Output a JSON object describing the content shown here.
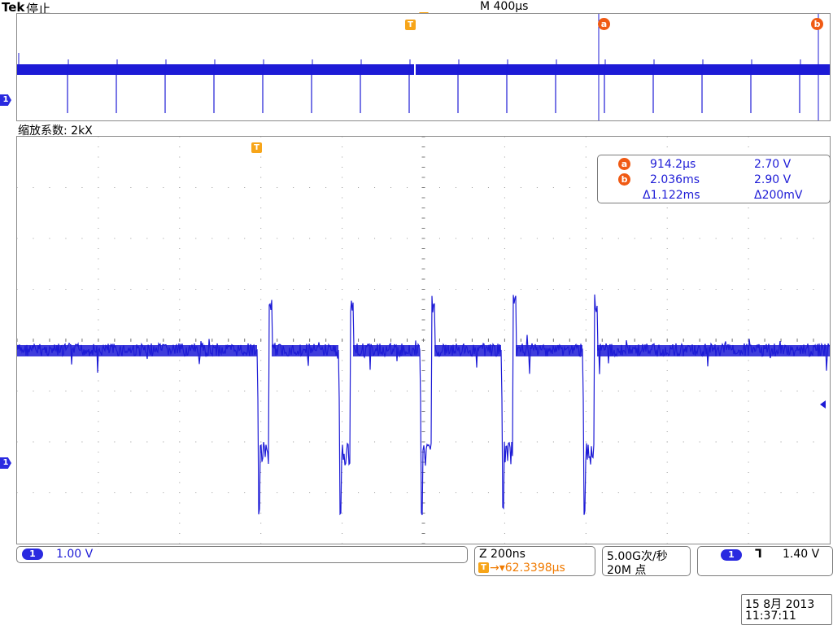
{
  "header": {
    "brand": "Tek",
    "status": "停止",
    "timebase": "M 400µs"
  },
  "overview": {
    "cursor_a_label": "a",
    "cursor_b_label": "b",
    "trigger_label": "T",
    "channel_indicator": "1"
  },
  "zoom": {
    "factor_label": "缩放系数: 2kX",
    "trigger_label": "T",
    "channel_indicator": "1"
  },
  "readout": {
    "a_label": "a",
    "a_time": "914.2µs",
    "a_volt": "2.70 V",
    "b_label": "b",
    "b_time": "2.036ms",
    "b_volt": "2.90 V",
    "delta_time": "Δ1.122ms",
    "delta_volt": "Δ200mV"
  },
  "status_bar": {
    "channel_badge": "1",
    "channel_scale": "1.00 V",
    "zoom_label": "Z 200ns",
    "trigger_pos_badge": "T",
    "trigger_pos": "→▾62.3398µs",
    "sample_rate": "5.00G次/秒",
    "record_length": "20M 点",
    "trigger_source": "1",
    "trigger_slope": "ᒣ",
    "trigger_level": "1.40 V"
  },
  "datetime": {
    "date": "15 8月  2013",
    "time": "11:37:11"
  },
  "colors": {
    "trace": "#1d1bd6",
    "cursor_marker": "#f05a14",
    "trigger_marker": "#f7a519",
    "grid": "#9a9a9a"
  }
}
